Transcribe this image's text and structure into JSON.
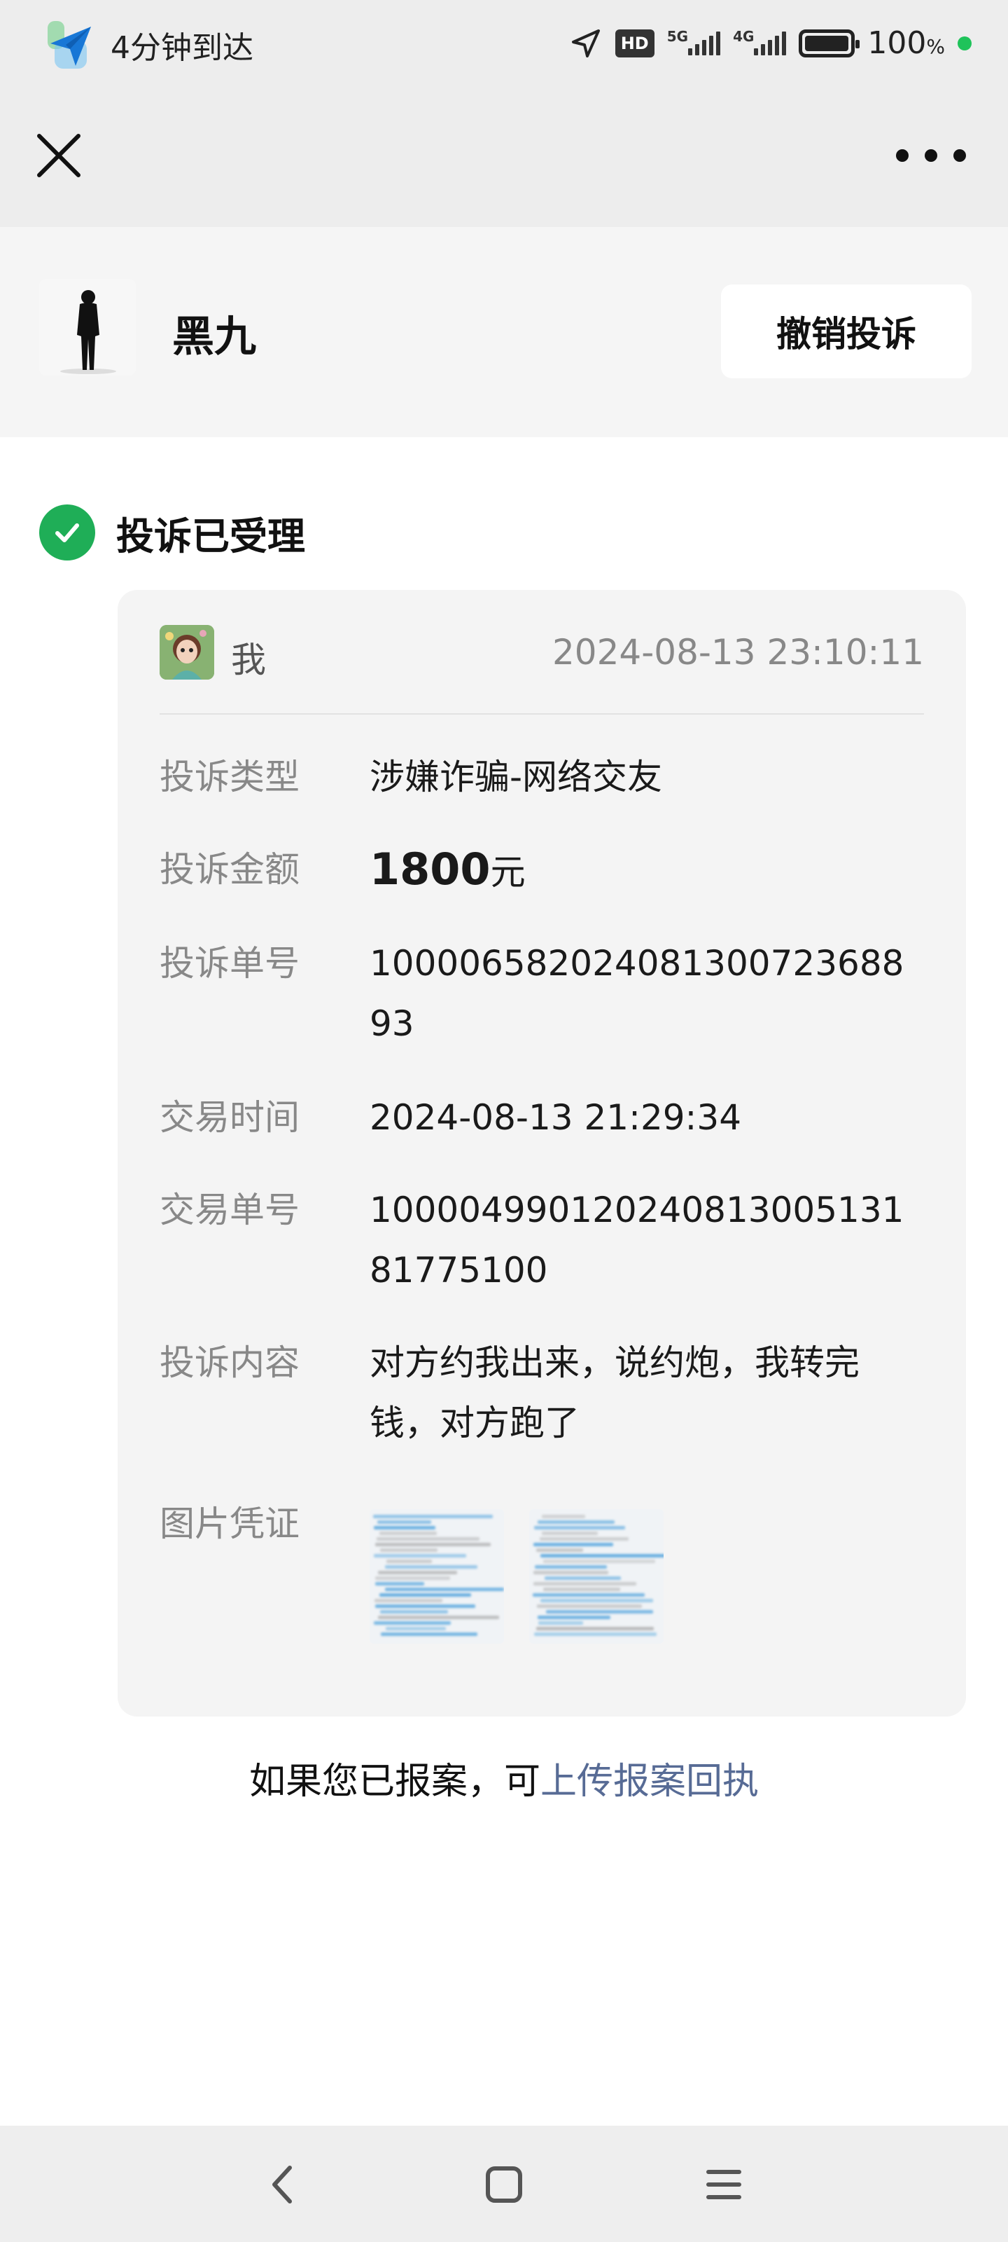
{
  "status_bar": {
    "nav_app_icon": "navigation-plane-icon",
    "eta_text": "4分钟到达",
    "hd_badge": "HD",
    "network_primary": "5G",
    "network_secondary": "4G",
    "battery_percent": "100",
    "battery_unit": "%",
    "battery_level": 1.0
  },
  "navbar": {
    "close_icon": "close-icon",
    "more_icon": "more-dots-icon"
  },
  "merchant": {
    "name": "黑九",
    "revoke_label": "撤销投诉"
  },
  "complaint_status": {
    "label": "投诉已受理",
    "icon": "check-circle-icon",
    "color": "#1fae57"
  },
  "card": {
    "user_name": "我",
    "submit_time": "2024-08-13 23:10:11",
    "fields": {
      "type_label": "投诉类型",
      "type_value": "涉嫌诈骗-网络交友",
      "amount_label": "投诉金额",
      "amount_value": "1800",
      "amount_unit": "元",
      "complaint_no_label": "投诉单号",
      "complaint_no_value": "100006582024081300723688 93",
      "trade_time_label": "交易时间",
      "trade_time_value": "2024-08-13 21:29:34",
      "trade_no_label": "交易单号",
      "trade_no_value": "100004990120240813005131 81775100",
      "content_label": "投诉内容",
      "content_value": "对方约我出来，说约炮，我转完钱，对方跑了",
      "proof_label": "图片凭证"
    }
  },
  "footer": {
    "tip_prefix": "如果您已报案，可",
    "tip_link": "上传报案回执",
    "link_color": "#576b95"
  },
  "system_nav": {
    "back_icon": "back-chevron-icon",
    "home_icon": "home-square-icon",
    "menu_icon": "menu-lines-icon"
  }
}
